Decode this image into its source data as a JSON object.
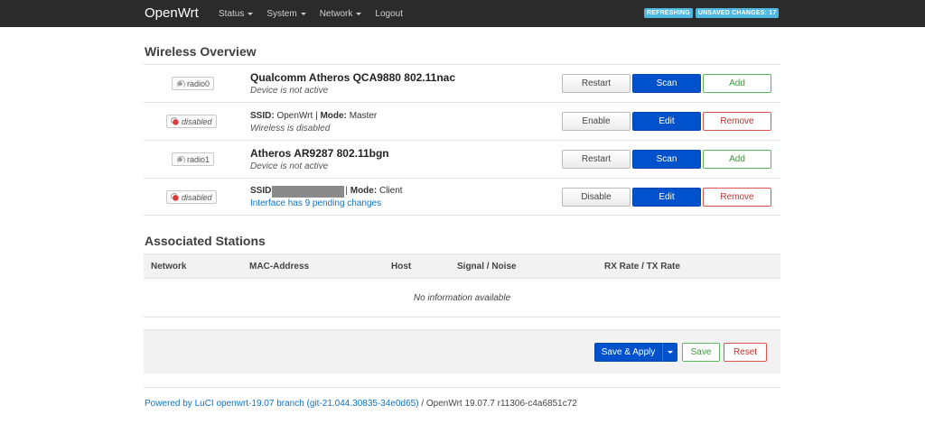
{
  "header": {
    "brand": "OpenWrt",
    "nav": [
      {
        "label": "Status",
        "dropdown": true
      },
      {
        "label": "System",
        "dropdown": true
      },
      {
        "label": "Network",
        "dropdown": true
      },
      {
        "label": "Logout",
        "dropdown": false
      }
    ],
    "indicators": [
      "REFRESHING",
      "UNSAVED CHANGES: 17"
    ]
  },
  "wireless": {
    "title": "Wireless Overview",
    "rows": [
      {
        "badge": "radio0",
        "badge_icon": "radio-icon",
        "title": "Qualcomm Atheros QCA9880 802.11nac",
        "subtitle": "Device is not active",
        "buttons": [
          "Restart",
          "Scan",
          "Add"
        ]
      },
      {
        "badge": "disabled",
        "badge_icon": "disabled-icon",
        "ssid_label": "SSID:",
        "ssid": "OpenWrt",
        "mode_label": "Mode:",
        "mode": "Master",
        "status": "Wireless is disabled",
        "buttons": [
          "Enable",
          "Edit",
          "Remove"
        ]
      },
      {
        "badge": "radio1",
        "badge_icon": "radio-icon",
        "title": "Atheros AR9287 802.11bgn",
        "subtitle": "Device is not active",
        "buttons": [
          "Restart",
          "Scan",
          "Add"
        ]
      },
      {
        "badge": "disabled",
        "badge_icon": "disabled-icon",
        "ssid_label": "SSID",
        "mode_label": "Mode:",
        "mode": "Client",
        "status": "Interface has 9 pending changes",
        "buttons": [
          "Disable",
          "Edit",
          "Remove"
        ]
      }
    ]
  },
  "stations": {
    "title": "Associated Stations",
    "columns": [
      "Network",
      "MAC-Address",
      "Host",
      "Signal / Noise",
      "RX Rate / TX Rate"
    ],
    "empty_text": "No information available"
  },
  "actions": {
    "save_apply": "Save & Apply",
    "save": "Save",
    "reset": "Reset"
  },
  "footer": {
    "link_text": "Powered by LuCI openwrt-19.07 branch (git-21.044.30835-34e0d65)",
    "rest": " / OpenWrt 19.07.7 r11306-c4a6851c72"
  },
  "colors": {
    "topbar": "#2b2b2b",
    "primary": "#0052cc",
    "indicator": "#4fb8e0",
    "link": "#0d74c9"
  }
}
